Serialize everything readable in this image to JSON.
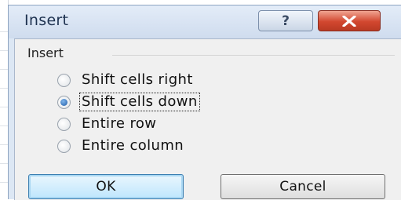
{
  "dialog": {
    "title": "Insert",
    "help_glyph": "?",
    "group_label": "Insert",
    "options": [
      {
        "label": "Shift cells right",
        "checked": false
      },
      {
        "label": "Shift cells down",
        "checked": true
      },
      {
        "label": "Entire row",
        "checked": false
      },
      {
        "label": "Entire column",
        "checked": false
      }
    ],
    "ok_label": "OK",
    "cancel_label": "Cancel"
  },
  "colors": {
    "close_button": "#d2472f",
    "default_button_border": "#3c7fb1",
    "dialog_frame": "#dce7f4"
  }
}
